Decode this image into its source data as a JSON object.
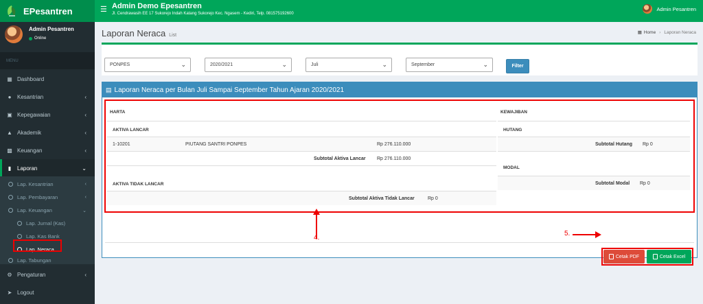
{
  "brand": {
    "name": "EPesantren"
  },
  "header": {
    "app_name": "Admin Demo Epesantren",
    "address": "Jl. Cendrawasih EE 17 Sukorejo Indah Katang Sukorejo Kec. Ngasem - Kediri, Telp. 081575192600",
    "user": "Admin Pesantren"
  },
  "sidebar": {
    "user_name": "Admin Pesantren",
    "status": "Online",
    "menu_header": "MENU",
    "items": [
      {
        "label": "Dashboard",
        "icon": "grid-icon"
      },
      {
        "label": "Kesantrian",
        "icon": "user-icon"
      },
      {
        "label": "Kepegawaian",
        "icon": "briefcase-icon"
      },
      {
        "label": "Akademik",
        "icon": "graduation-cap-icon"
      },
      {
        "label": "Keuangan",
        "icon": "money-icon"
      },
      {
        "label": "Laporan",
        "icon": "file-icon"
      },
      {
        "label": "Pengaturan",
        "icon": "gear-icon"
      },
      {
        "label": "Logout",
        "icon": "sign-out-icon"
      }
    ],
    "sub_items": [
      {
        "label": "Lap. Kesantrian"
      },
      {
        "label": "Lap. Pembayaran"
      },
      {
        "label": "Lap. Keuangan"
      },
      {
        "label": "Lap. Jurnal (Kas)"
      },
      {
        "label": "Lap. Kas Bank"
      },
      {
        "label": "Lap. Neraca"
      },
      {
        "label": "Lap. Tabungan"
      }
    ]
  },
  "page": {
    "title": "Laporan Neraca",
    "subtitle": "List",
    "breadcrumb_home": "Home",
    "breadcrumb_current": "Laporan Neraca"
  },
  "filter": {
    "unit": "PONPES",
    "year": "2020/2021",
    "month_from": "Juli",
    "month_to": "September",
    "button": "Filter"
  },
  "report": {
    "title": "Laporan Neraca per Bulan Juli Sampai September Tahun Ajaran 2020/2021",
    "harta": "HARTA",
    "aktiva_lancar": "AKTIVA LANCAR",
    "row_code": "1-10201",
    "row_name": "PIUTANG SANTRI PONPES",
    "row_value": "Rp 276.110.000",
    "subtotal_aktiva_lancar_label": "Subtotal Aktiva Lancar",
    "subtotal_aktiva_lancar_value": "Rp 276.110.000",
    "aktiva_tidak_lancar": "AKTIVA TIDAK LANCAR",
    "subtotal_aktiva_tidak_lancar_label": "Subtotal Aktiva Tidak Lancar",
    "subtotal_aktiva_tidak_lancar_value": "Rp 0",
    "kewajiban": "KEWAJIBAN",
    "hutang": "HUTANG",
    "subtotal_hutang_label": "Subtotal Hutang",
    "subtotal_hutang_value": "Rp 0",
    "modal": "MODAL",
    "subtotal_modal_label": "Subtotal Modal",
    "subtotal_modal_value": "Rp 0",
    "pdf_button": "Cetak PDF",
    "excel_button": "Cetak Excel"
  },
  "annotations": {
    "four": "4.",
    "five": "5."
  },
  "colors": {
    "brand_green": "#00a65a",
    "sidebar_dark": "#222d32",
    "box_blue": "#3c8dbc",
    "danger_red": "#dd4b39",
    "annotation_red": "#ee0000"
  }
}
